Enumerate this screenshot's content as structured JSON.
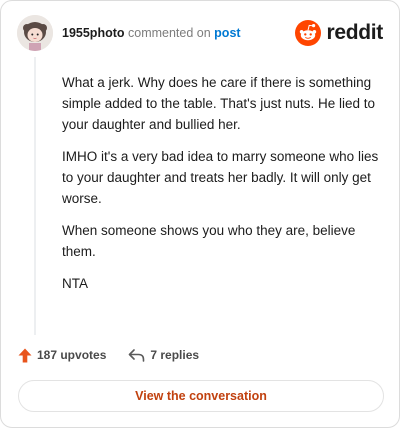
{
  "comment": {
    "username": "1955photo",
    "action": "commented on",
    "post_link": "post"
  },
  "brand": {
    "name": "reddit",
    "accent": "#ff4500"
  },
  "body": {
    "paragraphs": [
      "What a jerk. Why does he care if there is something simple added to the table. That's just nuts. He lied to your daughter and bullied her.",
      "IMHO it's a very bad idea to marry someone who lies to your daughter and treats her badly. It will only get worse.",
      "When someone shows you who they are, believe them.",
      "NTA"
    ]
  },
  "footer": {
    "upvotes": "187 upvotes",
    "replies": "7 replies"
  },
  "cta": {
    "label": "View the conversation"
  },
  "colors": {
    "upvote_icon": "#e8541c",
    "link": "#0079d3",
    "cta_text": "#c1410f"
  },
  "icons": {
    "avatar": "user-avatar",
    "logo": "reddit-snoo-icon",
    "upvote": "upvote-arrow-icon",
    "reply": "reply-arrow-icon"
  }
}
